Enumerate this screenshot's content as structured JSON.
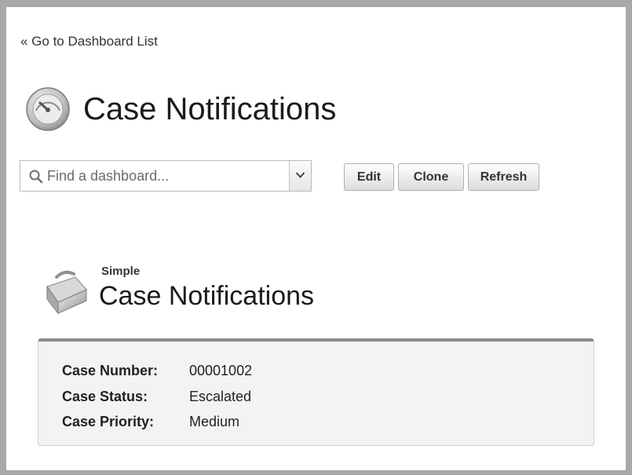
{
  "nav": {
    "back_link": "« Go to Dashboard List"
  },
  "header": {
    "title": "Case Notifications",
    "icon": "dashboard-gauge-icon"
  },
  "search": {
    "placeholder": "Find a dashboard...",
    "value": ""
  },
  "toolbar": {
    "edit_label": "Edit",
    "clone_label": "Clone",
    "refresh_label": "Refresh"
  },
  "component": {
    "icon": "toolbox-icon",
    "subtitle": "Simple",
    "title": "Case Notifications",
    "fields": [
      {
        "label": "Case Number:",
        "value": "00001002"
      },
      {
        "label": "Case Status:",
        "value": "Escalated"
      },
      {
        "label": "Case Priority:",
        "value": "Medium"
      }
    ]
  },
  "colors": {
    "frame_border": "#a8a8a8",
    "panel_background": "#f3f3f3",
    "panel_top_border": "#8c8c8c"
  }
}
